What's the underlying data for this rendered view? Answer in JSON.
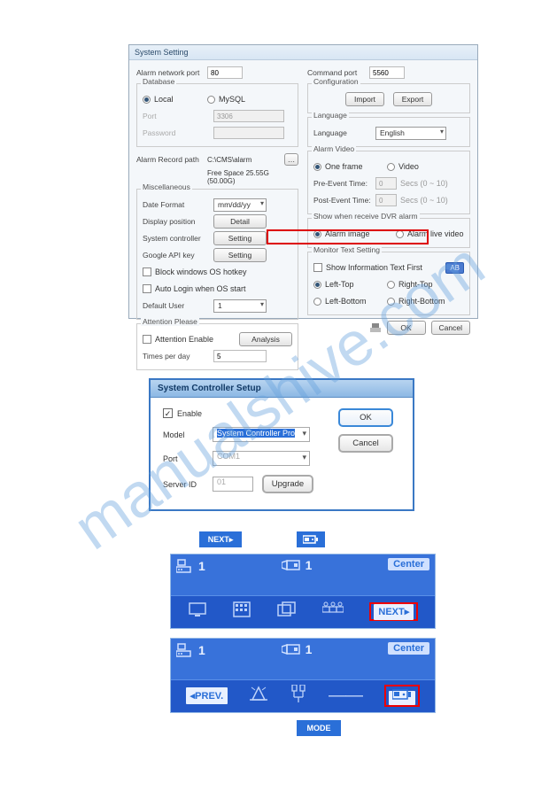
{
  "watermark": "manualshive.com",
  "dialog1": {
    "title": "System Setting",
    "alarm_network_port_label": "Alarm network port",
    "alarm_network_port_value": "80",
    "command_port_label": "Command port",
    "command_port_value": "5560",
    "db": {
      "legend": "Database",
      "local_label": "Local",
      "mysql_label": "MySQL",
      "port_label": "Port",
      "port_value": "3306",
      "password_label": "Password",
      "password_value": ""
    },
    "alarm_record_path_label": "Alarm Record path",
    "alarm_record_path_value": "C:\\CMS\\alarm",
    "free_space_text": "Free Space 25.55G (50.00G)",
    "misc": {
      "legend": "Miscellaneous",
      "date_format_label": "Date Format",
      "date_format_value": "mm/dd/yy",
      "display_position_label": "Display position",
      "detail_btn": "Detail",
      "system_controller_label": "System controller",
      "setting_btn": "Setting",
      "google_api_label": "Google API key",
      "setting_btn2": "Setting",
      "block_hotkey_label": "Block windows OS hotkey",
      "auto_login_label": "Auto Login when OS start",
      "default_user_label": "Default User",
      "default_user_value": "1"
    },
    "attention": {
      "legend": "Attention Please",
      "enable_label": "Attention Enable",
      "analysis_btn": "Analysis",
      "times_label": "Times per day",
      "times_value": "5"
    },
    "config": {
      "legend": "Configuration",
      "import_btn": "Import",
      "export_btn": "Export"
    },
    "lang": {
      "legend": "Language",
      "language_label": "Language",
      "language_value": "English"
    },
    "alarm_video": {
      "legend": "Alarm Video",
      "one_frame_label": "One frame",
      "video_label": "Video",
      "pre_event_label": "Pre-Event Time:",
      "pre_event_value": "0",
      "post_event_label": "Post-Event Time:",
      "post_event_value": "0",
      "secs_label": "Secs (0 ~ 10)"
    },
    "show_alarm": {
      "legend": "Show when receive DVR alarm",
      "alarm_image_label": "Alarm image",
      "alarm_live_label": "Alarm live video"
    },
    "monitor_text": {
      "legend": "Monitor Text Setting",
      "show_info_label": "Show Information Text First",
      "ab_btn": "AB",
      "left_top": "Left-Top",
      "right_top": "Right-Top",
      "left_bottom": "Left-Bottom",
      "right_bottom": "Right-Bottom"
    },
    "ok_btn": "OK",
    "cancel_btn": "Cancel"
  },
  "dialog2": {
    "title": "System Controller Setup",
    "enable_label": "Enable",
    "model_label": "Model",
    "model_value": "System Controller Pro",
    "port_label": "Port",
    "port_value": "COM1",
    "server_id_label": "Server ID",
    "server_id_value": "01",
    "ok_btn": "OK",
    "cancel_btn": "Cancel",
    "upgrade_btn": "Upgrade"
  },
  "labels": {
    "next_under": "NEXT▸",
    "mode_bottom": "MODE"
  },
  "panel1": {
    "id1": "1",
    "id2": "1",
    "center": "Center",
    "next": "NEXT▸"
  },
  "panel2": {
    "id1": "1",
    "id2": "1",
    "center": "Center",
    "prev": "◂PREV."
  }
}
